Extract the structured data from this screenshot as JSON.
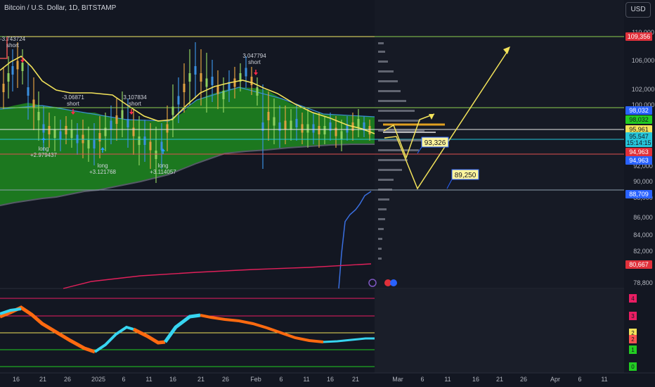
{
  "header": {
    "title": "Bitcoin / U.S. Dollar, 1D, BITSTAMP",
    "currency": "USD"
  },
  "colors": {
    "background": "#131722",
    "cloud": "#1e8a1e",
    "ema": "#f2e25a",
    "upper_band": "#e05050",
    "lower_band": "#555a66",
    "projection": "#f2e25a",
    "blue_line": "#3a6fe0",
    "pink_line": "#e0205a",
    "osc_orange": "#ff6a10",
    "osc_cyan": "#37d5f0"
  },
  "chart_data": {
    "type": "line",
    "x_ticks": [
      "16",
      "21",
      "26",
      "2025",
      "6",
      "11",
      "16",
      "21",
      "26",
      "Feb",
      "6",
      "11",
      "16",
      "21",
      "Mar",
      "6",
      "11",
      "16",
      "21",
      "26",
      "Apr",
      "6",
      "11"
    ],
    "y_ticks": [
      "110,000",
      "106,000",
      "102,000",
      "100,000",
      "92,000",
      "90,000",
      "88,000",
      "86,000",
      "84,000",
      "82,000",
      "78,800"
    ],
    "price_labels": [
      {
        "text": "109,356",
        "color": "#e0303a"
      },
      {
        "text": "98,032",
        "color": "#2962ff"
      },
      {
        "text": "98,032",
        "color": "#22cc22"
      },
      {
        "text": "95,961",
        "color": "#f2e25a"
      },
      {
        "text": "95,547",
        "color": "#26c6da"
      },
      {
        "text": "15:14:15",
        "color": "#26c6da"
      },
      {
        "text": "94,963",
        "color": "#e0303a"
      },
      {
        "text": "94,963",
        "color": "#2962ff"
      },
      {
        "text": "88,709",
        "color": "#2962ff"
      },
      {
        "text": "80,667",
        "color": "#e0303a"
      }
    ],
    "annotations": [
      {
        "text": "-3.743724",
        "sub": "short"
      },
      {
        "text": "-3.06871",
        "sub": "short"
      },
      {
        "text": "3.107834",
        "sub": "short"
      },
      {
        "text": "3.047794",
        "sub": "short"
      },
      {
        "text": "long",
        "sub": "+2.979437"
      },
      {
        "text": "long",
        "sub": "+3.121768"
      },
      {
        "text": "long",
        "sub": "+3.114057"
      }
    ],
    "target_labels": [
      "93,326",
      "89,250"
    ],
    "oscillator_levels": [
      {
        "text": "4",
        "color": "#e91e63"
      },
      {
        "text": "3",
        "color": "#e91e63"
      },
      {
        "text": "2",
        "color": "#f2e25a"
      },
      {
        "text": "2",
        "color": "#ff5252"
      },
      {
        "text": "1",
        "color": "#22cc22"
      },
      {
        "text": "0",
        "color": "#22cc22"
      }
    ]
  }
}
